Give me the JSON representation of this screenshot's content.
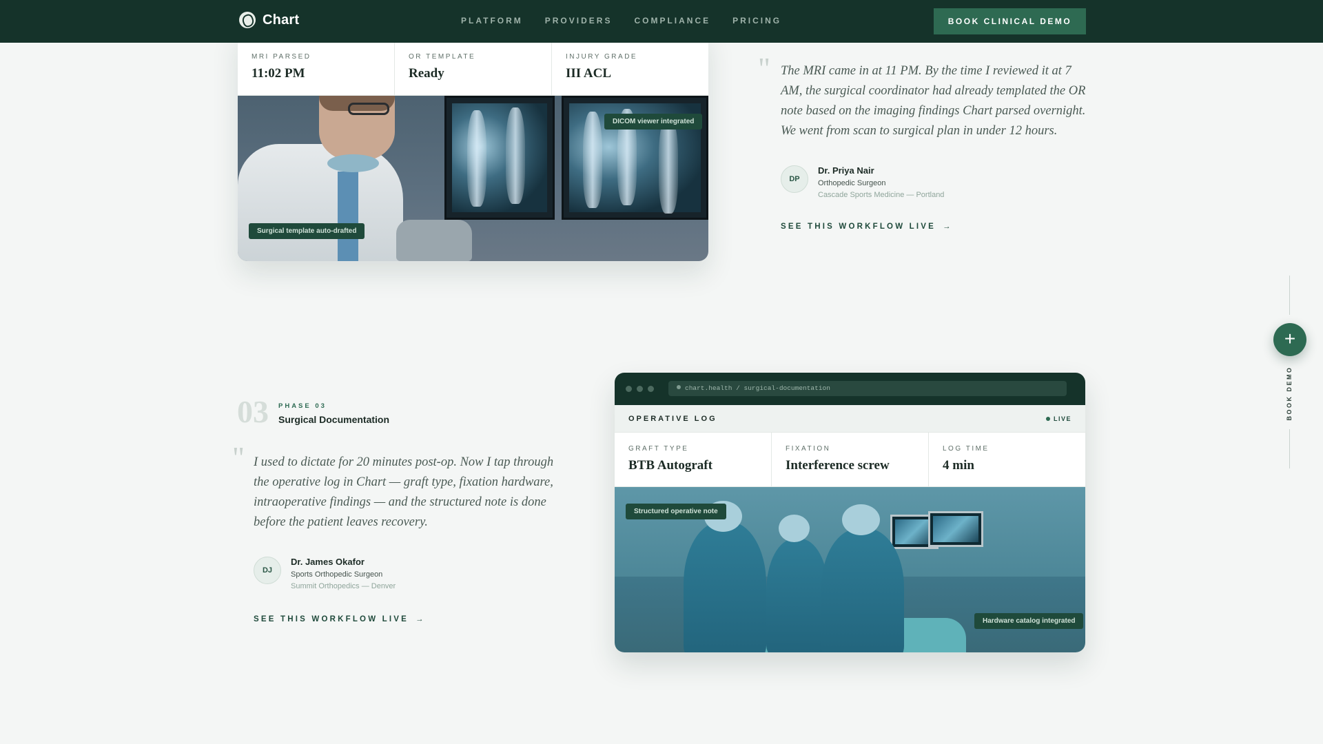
{
  "nav": {
    "brand": "Chart",
    "links": [
      "PLATFORM",
      "PROVIDERS",
      "COMPLIANCE",
      "PRICING"
    ],
    "cta": "BOOK CLINICAL DEMO"
  },
  "phase02": {
    "stats": [
      {
        "label": "MRI PARSED",
        "value": "11:02 PM"
      },
      {
        "label": "OR TEMPLATE",
        "value": "Ready"
      },
      {
        "label": "INJURY GRADE",
        "value": "III ACL"
      }
    ],
    "badges": {
      "top": "DICOM viewer integrated",
      "bottom": "Surgical template auto-drafted"
    },
    "quote": "The MRI came in at 11 PM. By the time I reviewed it at 7 AM, the surgical coordinator had already templated the OR note based on the imaging findings Chart parsed overnight. We went from scan to surgical plan in under 12 hours.",
    "person": {
      "initials": "DP",
      "name": "Dr. Priya Nair",
      "role": "Orthopedic Surgeon",
      "org": "Cascade Sports Medicine — Portland"
    },
    "cta": "SEE THIS WORKFLOW LIVE"
  },
  "phase03": {
    "number": "03",
    "eyebrow": "PHASE 03",
    "title": "Surgical Documentation",
    "quote": "I used to dictate for 20 minutes post-op. Now I tap through the operative log in Chart — graft type, fixation hardware, intraoperative findings — and the structured note is done before the patient leaves recovery.",
    "person": {
      "initials": "DJ",
      "name": "Dr. James Okafor",
      "role": "Sports Orthopedic Surgeon",
      "org": "Summit Orthopedics — Denver"
    },
    "cta": "SEE THIS WORKFLOW LIVE",
    "window": {
      "url": "chart.health / surgical-documentation",
      "title": "OPERATIVE LOG",
      "status": "LIVE",
      "stats": [
        {
          "label": "GRAFT TYPE",
          "value": "BTB Autograft"
        },
        {
          "label": "FIXATION",
          "value": "Interference screw"
        },
        {
          "label": "LOG TIME",
          "value": "4 min"
        }
      ],
      "badges": {
        "top": "Structured operative note",
        "bottom": "Hardware catalog integrated"
      }
    }
  },
  "side_rail": {
    "label": "BOOK DEMO",
    "icon": "plus-icon"
  },
  "colors": {
    "nav_bg": "#15332a",
    "accent": "#2d6a52",
    "page_bg": "#f4f6f5"
  }
}
